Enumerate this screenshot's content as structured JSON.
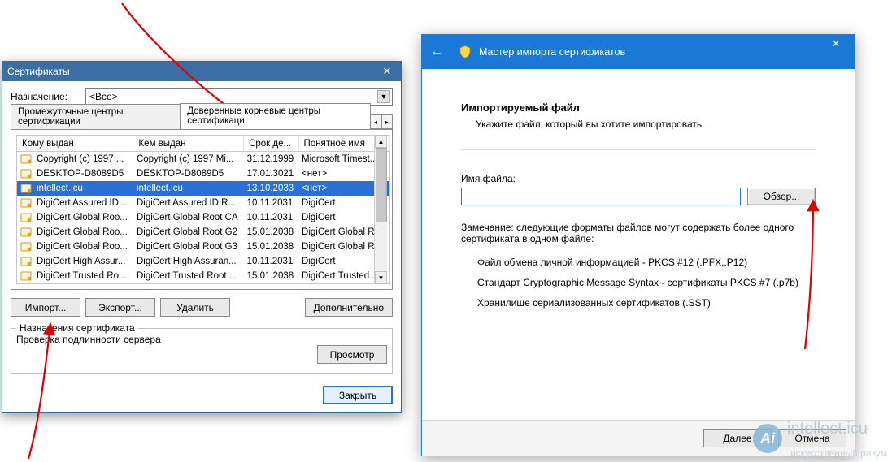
{
  "cert_dialog": {
    "title": "Сертификаты",
    "purpose_label": "Назначение:",
    "purpose_value": "<Все>",
    "tabs": [
      {
        "label": "Промежуточные центры сертификации"
      },
      {
        "label": "Доверенные корневые центры сертификаци"
      }
    ],
    "columns": {
      "issued_to": "Кому выдан",
      "issued_by": "Кем выдан",
      "expires": "Срок де...",
      "friendly_name": "Понятное имя"
    },
    "rows": [
      {
        "issued_to": "Copyright (c) 1997 ...",
        "issued_by": "Copyright (c) 1997 Mi...",
        "expires": "31.12.1999",
        "friendly_name": "Microsoft Timest...",
        "selected": false
      },
      {
        "issued_to": "DESKTOP-D8089D5",
        "issued_by": "DESKTOP-D8089D5",
        "expires": "17.01.3021",
        "friendly_name": "<нет>",
        "selected": false
      },
      {
        "issued_to": "intellect.icu",
        "issued_by": "intellect.icu",
        "expires": "13.10.2033",
        "friendly_name": "<нет>",
        "selected": true
      },
      {
        "issued_to": "DigiCert Assured ID...",
        "issued_by": "DigiCert Assured ID R...",
        "expires": "10.11.2031",
        "friendly_name": "DigiCert",
        "selected": false
      },
      {
        "issued_to": "DigiCert Global Roo...",
        "issued_by": "DigiCert Global Root CA",
        "expires": "10.11.2031",
        "friendly_name": "DigiCert",
        "selected": false
      },
      {
        "issued_to": "DigiCert Global Roo...",
        "issued_by": "DigiCert Global Root G2",
        "expires": "15.01.2038",
        "friendly_name": "DigiCert Global R...",
        "selected": false
      },
      {
        "issued_to": "DigiCert Global Roo...",
        "issued_by": "DigiCert Global Root G3",
        "expires": "15.01.2038",
        "friendly_name": "DigiCert Global R...",
        "selected": false
      },
      {
        "issued_to": "DigiCert High Assur...",
        "issued_by": "DigiCert High Assuran...",
        "expires": "10.11.2031",
        "friendly_name": "DigiCert",
        "selected": false
      },
      {
        "issued_to": "DigiCert Trusted Ro...",
        "issued_by": "DigiCert Trusted Root ...",
        "expires": "15.01.2038",
        "friendly_name": "DigiCert Trusted ...",
        "selected": false
      }
    ],
    "buttons": {
      "import": "Импорт...",
      "export": "Экспорт...",
      "remove": "Удалить",
      "advanced": "Дополнительно"
    },
    "group_title": "Назначения сертификата",
    "group_text": "Проверка подлинности сервера",
    "view_btn": "Просмотр",
    "close_btn": "Закрыть"
  },
  "wizard": {
    "title": "Мастер импорта сертификатов",
    "heading": "Импортируемый файл",
    "subtitle": "Укажите файл, который вы хотите импортировать.",
    "filename_label": "Имя файла:",
    "filename_value": "",
    "browse": "Обзор...",
    "note": "Замечание: следующие форматы файлов могут содержать более одного сертификата в одном файле:",
    "formats": [
      "Файл обмена личной информацией - PKCS #12 (.PFX,.P12)",
      "Стандарт Cryptographic Message Syntax - сертификаты PKCS #7 (.p7b)",
      "Хранилище сериализованных сертификатов (.SST)"
    ],
    "next": "Далее",
    "cancel": "Отмена"
  },
  "watermark": {
    "brand": "intellect.icu",
    "tagline": "искусственный разум"
  }
}
